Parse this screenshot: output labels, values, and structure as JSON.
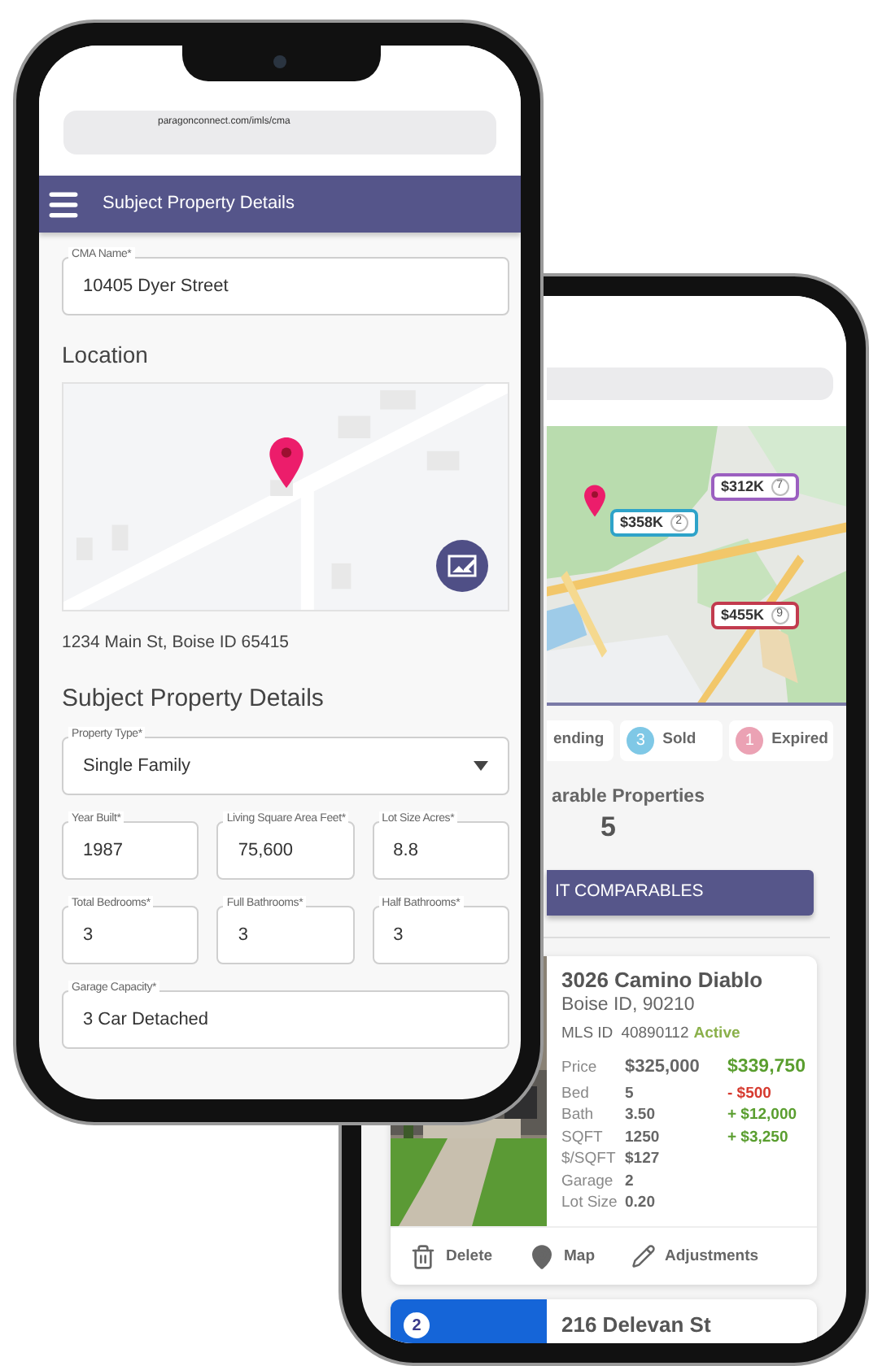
{
  "front_phone": {
    "url": "paragonconnect.com/imls/cma",
    "app_bar": {
      "title": "Subject Property Details"
    },
    "cma_field": {
      "label": "CMA Name*",
      "value": "10405 Dyer Street"
    },
    "location": {
      "heading": "Location",
      "address": "1234 Main St, Boise ID 65415"
    },
    "details": {
      "heading": "Subject Property Details",
      "rows": [
        {
          "fields": [
            {
              "label": "Property Type*",
              "value": "Single Family",
              "kind": "select"
            }
          ]
        },
        {
          "fields": [
            {
              "label": "Year Built*",
              "value": "1987",
              "kind": "text"
            },
            {
              "label": "Living Square Area Feet*",
              "value": "75,600",
              "kind": "text"
            },
            {
              "label": "Lot Size Acres*",
              "value": "8.8",
              "kind": "text"
            }
          ]
        },
        {
          "fields": [
            {
              "label": "Total Bedrooms*",
              "value": "3",
              "kind": "text"
            },
            {
              "label": "Full Bathrooms*",
              "value": "3",
              "kind": "text"
            },
            {
              "label": "Half Bathrooms*",
              "value": "3",
              "kind": "text"
            }
          ]
        },
        {
          "fields": [
            {
              "label": "Garage Capacity*",
              "value": "3 Car Detached",
              "kind": "text"
            }
          ]
        }
      ]
    }
  },
  "back_phone": {
    "map": {
      "markers": [
        {
          "price": "$312K",
          "count": "7",
          "color": "#9b5fc0"
        },
        {
          "price": "$358K",
          "count": "2",
          "color": "#2ea3c9"
        },
        {
          "price": "$455K",
          "count": "9",
          "color": "#c23b4e"
        }
      ]
    },
    "status_pills": [
      {
        "label": "ending"
      },
      {
        "count": "3",
        "label": "Sold",
        "color": "#7fc8e6"
      },
      {
        "count": "1",
        "label": "Expired",
        "color": "#eba2b4"
      }
    ],
    "comparables": {
      "label": "arable Properties",
      "count": "5"
    },
    "edit_button": "IT COMPARABLES",
    "cards": [
      {
        "kind": "full",
        "title": "3026 Camino Diablo",
        "subtitle": "Boise ID, 90210",
        "mls_label": "MLS ID",
        "mls_id": "40890112",
        "status": "Active",
        "rows": [
          {
            "label": "Price",
            "value": "$325,000",
            "adjustment": "$339,750",
            "color": "#5a9e2f"
          },
          {
            "label": "Bed",
            "value": "5",
            "adjustment": "- $500",
            "color": "#d63a2f"
          },
          {
            "label": "Bath",
            "value": "3.50",
            "adjustment": "+ $12,000",
            "color": "#5a9e2f"
          },
          {
            "label": "SQFT",
            "value": "1250",
            "adjustment": "+ $3,250",
            "color": "#5a9e2f"
          },
          {
            "label": "$/SQFT",
            "value": "$127"
          },
          {
            "label": "Garage",
            "value": "2"
          },
          {
            "label": "Lot Size",
            "value": "0.20"
          }
        ],
        "actions": [
          {
            "label": "Delete",
            "kind": "delete"
          },
          {
            "label": "Map",
            "kind": "map"
          },
          {
            "label": "Adjustments",
            "kind": "edit"
          }
        ]
      },
      {
        "kind": "partial",
        "badge": "2",
        "title": "216 Delevan St"
      }
    ]
  }
}
